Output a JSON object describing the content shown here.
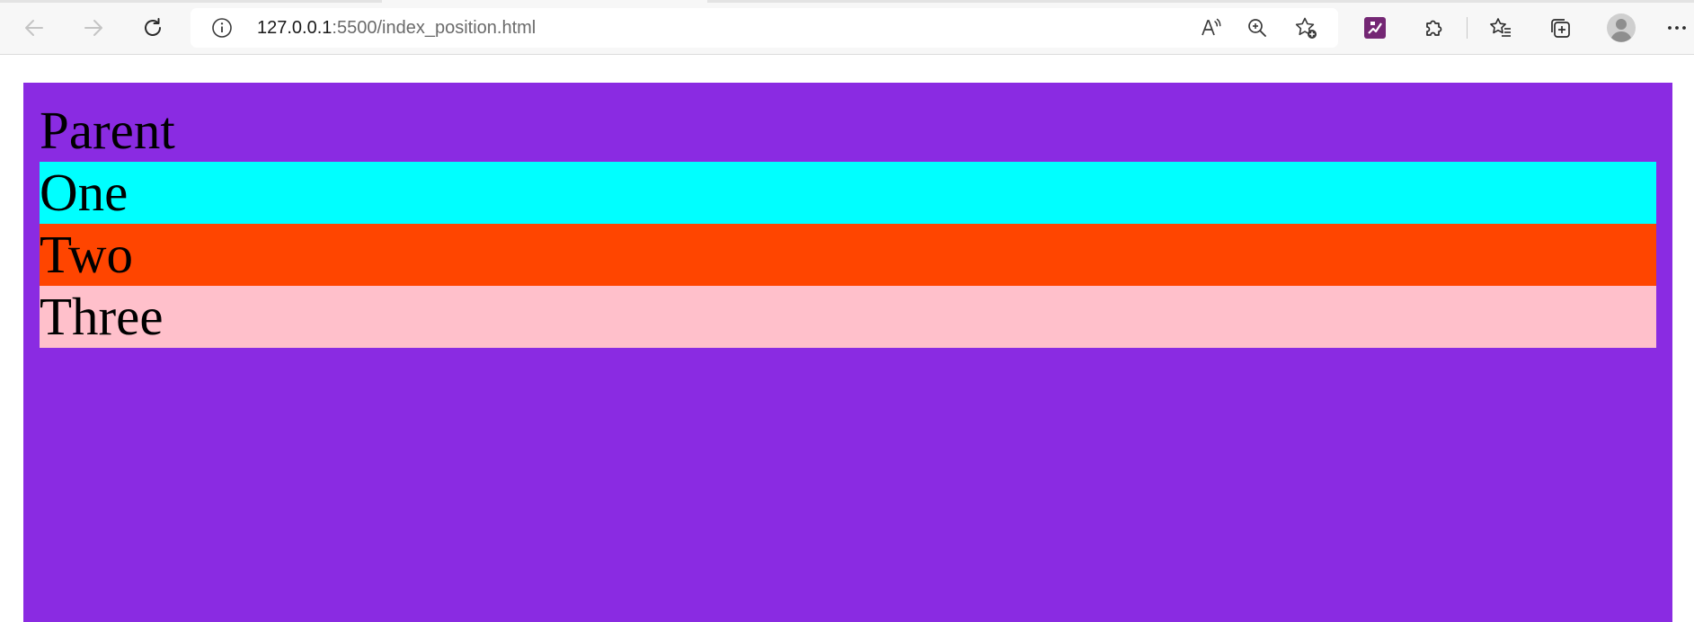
{
  "browser": {
    "address_bar": {
      "url_host": "127.0.0.1",
      "url_rest": ":5500/index_position.html"
    },
    "icons": {
      "back": "back-arrow-icon",
      "forward": "forward-arrow-icon",
      "refresh": "refresh-icon",
      "site_info": "info-icon",
      "read_aloud": "read-aloud-icon",
      "zoom": "zoom-in-icon",
      "add_favorite": "add-favorite-icon",
      "extension": "power-apps-extension-icon",
      "extensions": "extensions-puzzle-icon",
      "favorites": "favorites-icon",
      "collections": "collections-icon",
      "profile": "profile-avatar-icon",
      "more": "more-options-icon"
    }
  },
  "page": {
    "parent": {
      "label": "Parent",
      "color": "#8a2be2"
    },
    "children": [
      {
        "label": "One",
        "color": "#00ffff"
      },
      {
        "label": "Two",
        "color": "#ff4500"
      },
      {
        "label": "Three",
        "color": "#ffc0cb"
      }
    ]
  }
}
